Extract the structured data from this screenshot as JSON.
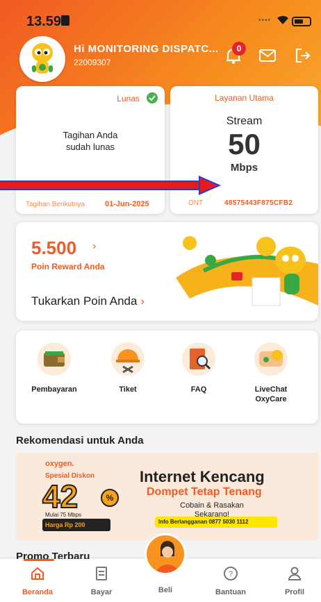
{
  "status_bar": {
    "time": "13.59"
  },
  "profile": {
    "greeting": "Hi MONITORING DISPATC...",
    "customer_id": "22009307",
    "notification_count": "0"
  },
  "bill": {
    "status": "Lunas",
    "message_line1": "Tagihan Anda",
    "message_line2": "sudah lunas",
    "next_label": "Tagihan Berikutnya",
    "next_date": "01-Jun-2025"
  },
  "service": {
    "title": "Layanan Utama",
    "name": "Stream",
    "speed": "50",
    "unit": "Mbps",
    "ont_label": "ONT",
    "ont_value": "48575443F875CFB2"
  },
  "reward": {
    "points": "5.500",
    "points_label": "Poin Reward Anda",
    "redeem_label": "Tukarkan Poin Anda"
  },
  "menu": {
    "items": [
      {
        "label": "Pembayaran",
        "icon": "wallet-icon"
      },
      {
        "label": "Tiket",
        "icon": "helmet-tools-icon"
      },
      {
        "label": "FAQ",
        "icon": "book-magnifier-icon"
      },
      {
        "label": "LiveChat OxyCare",
        "icon": "chat-bubble-icon"
      }
    ]
  },
  "recommendation": {
    "title": "Rekomendasi untuk Anda"
  },
  "banner": {
    "brand": "oxygen.",
    "discount_label": "Spesial Diskon",
    "discount_value": "42",
    "discount_pct": "%",
    "from_text": "Mulai 75 Mbps",
    "price_text": "Harga Rp 200",
    "headline": "Internet Kencang",
    "subheadline": "Dompet Tetap Tenang",
    "cta_line1": "Cobain & Rasakan",
    "cta_line2": "Sekarang!",
    "info": "Info Berlangganan  0877 5030 1112"
  },
  "promo": {
    "title": "Promo Terbaru"
  },
  "nav": {
    "items": [
      {
        "label": "Beranda",
        "icon": "home-icon"
      },
      {
        "label": "Bayar",
        "icon": "receipt-icon"
      },
      {
        "label": "Beli",
        "icon": "buy-avatar-icon"
      },
      {
        "label": "Bantuan",
        "icon": "help-icon"
      },
      {
        "label": "Profil",
        "icon": "person-icon"
      }
    ]
  },
  "colors": {
    "primary": "#f15a22",
    "accent": "#f7931e",
    "success": "#4caf50"
  }
}
